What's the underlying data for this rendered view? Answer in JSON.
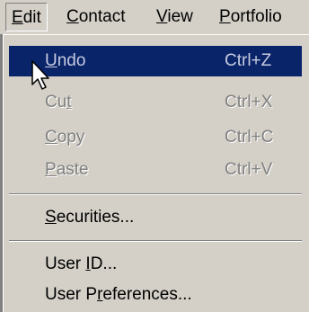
{
  "menubar": {
    "items": [
      {
        "pre": "",
        "mnemonic": "E",
        "post": "dit"
      },
      {
        "pre": "",
        "mnemonic": "C",
        "post": "ontact"
      },
      {
        "pre": "",
        "mnemonic": "V",
        "post": "iew"
      },
      {
        "pre": "",
        "mnemonic": "P",
        "post": "ortfolio"
      }
    ]
  },
  "edit_menu": {
    "undo": {
      "pre": "",
      "mnemonic": "U",
      "post": "ndo",
      "shortcut": "Ctrl+Z"
    },
    "cut": {
      "pre": "Cu",
      "mnemonic": "t",
      "post": "",
      "shortcut": "Ctrl+X"
    },
    "copy": {
      "pre": "",
      "mnemonic": "C",
      "post": "opy",
      "shortcut": "Ctrl+C"
    },
    "paste": {
      "pre": "",
      "mnemonic": "P",
      "post": "aste",
      "shortcut": "Ctrl+V"
    },
    "securities": {
      "pre": "",
      "mnemonic": "S",
      "post": "ecurities..."
    },
    "user_id": {
      "pre": "User ",
      "mnemonic": "I",
      "post": "D..."
    },
    "user_preferences": {
      "pre": "User P",
      "mnemonic": "r",
      "post": "eferences..."
    }
  },
  "colors": {
    "menu_background": "#d4d0c8",
    "highlight": "#0a246a",
    "disabled_text": "#808080"
  },
  "icons": {
    "cursor": "arrow-pointer-icon"
  }
}
